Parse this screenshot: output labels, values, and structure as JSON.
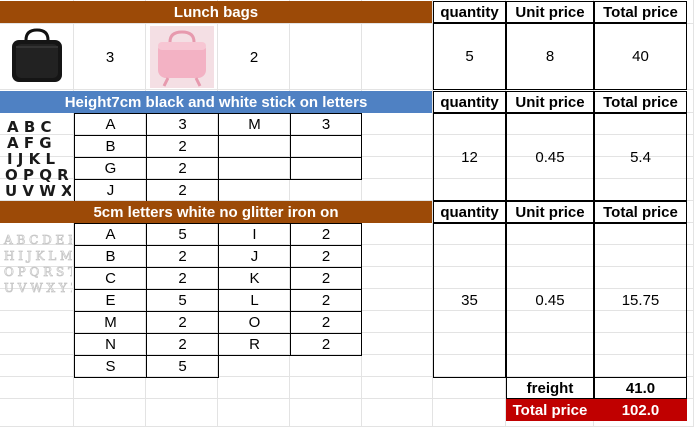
{
  "section1": {
    "title": "Lunch bags",
    "header": {
      "quantity": "quantity",
      "unit_price": "Unit price",
      "total_price": "Total price"
    },
    "item1_qty": "3",
    "item2_qty": "2",
    "quantity": "5",
    "unit_price": "8",
    "total_price": "40"
  },
  "section2": {
    "title": "Height7cm black and white stick on letters",
    "header": {
      "quantity": "quantity",
      "unit_price": "Unit price",
      "total_price": "Total price"
    },
    "image_text": "ABC\nAFG\nIJKLI\nOPQRS\nUVWX",
    "rows": [
      {
        "l1": "A",
        "q1": "3",
        "l2": "M",
        "q2": "3"
      },
      {
        "l1": "B",
        "q1": "2",
        "l2": "",
        "q2": ""
      },
      {
        "l1": "G",
        "q1": "2",
        "l2": "",
        "q2": ""
      },
      {
        "l1": "J",
        "q1": "2",
        "l2": "",
        "q2": ""
      }
    ],
    "quantity": "12",
    "unit_price": "0.45",
    "total_price": "5.4"
  },
  "section3": {
    "title": "5cm letters white no glitter iron on",
    "header": {
      "quantity": "quantity",
      "unit_price": "Unit price",
      "total_price": "Total price"
    },
    "rows": [
      {
        "l1": "A",
        "q1": "5",
        "l2": "I",
        "q2": "2"
      },
      {
        "l1": "B",
        "q1": "2",
        "l2": "J",
        "q2": "2"
      },
      {
        "l1": "C",
        "q1": "2",
        "l2": "K",
        "q2": "2"
      },
      {
        "l1": "E",
        "q1": "5",
        "l2": "L",
        "q2": "2"
      },
      {
        "l1": "M",
        "q1": "2",
        "l2": "O",
        "q2": "2"
      },
      {
        "l1": "N",
        "q1": "2",
        "l2": "R",
        "q2": "2"
      },
      {
        "l1": "S",
        "q1": "5",
        "l2": "",
        "q2": ""
      }
    ],
    "quantity": "35",
    "unit_price": "0.45",
    "total_price": "15.75"
  },
  "summary": {
    "freight_label": "freight",
    "freight_value": "41.0",
    "total_label": "Total price",
    "total_value": "102.0"
  },
  "colors": {
    "brown_banner": "#9c4a07",
    "blue_banner": "#4f81c3",
    "total_red": "#c00000"
  }
}
